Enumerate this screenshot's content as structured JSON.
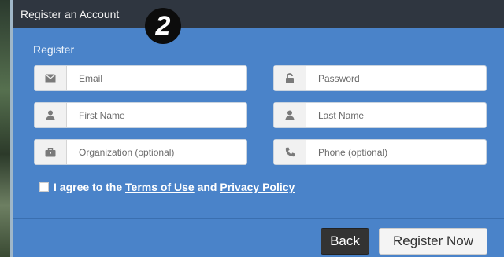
{
  "dialog": {
    "title": "Register an Account",
    "step": "2",
    "heading": "Register"
  },
  "fields": {
    "email": {
      "placeholder": "Email",
      "icon": "envelope-icon"
    },
    "password": {
      "placeholder": "Password",
      "icon": "lock-icon"
    },
    "first_name": {
      "placeholder": "First Name",
      "icon": "user-icon"
    },
    "last_name": {
      "placeholder": "Last Name",
      "icon": "user-icon"
    },
    "organization": {
      "placeholder": "Organization (optional)",
      "icon": "briefcase-icon"
    },
    "phone": {
      "placeholder": "Phone (optional)",
      "icon": "phone-icon"
    }
  },
  "agree": {
    "prefix": "I agree to the ",
    "terms": "Terms of Use",
    "and": " and ",
    "privacy": "Privacy Policy"
  },
  "buttons": {
    "back": "Back",
    "register": "Register Now"
  }
}
